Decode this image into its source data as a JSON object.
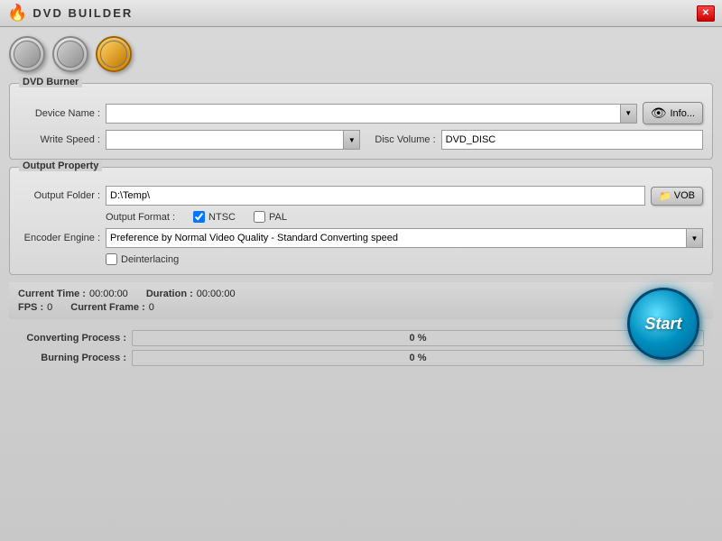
{
  "window": {
    "title": "DVD BUILDER",
    "close_label": "✕"
  },
  "toolbar": {
    "btn1_label": "",
    "btn2_label": "",
    "btn3_label": ""
  },
  "dvd_burner": {
    "title": "DVD Burner",
    "device_name_label": "Device Name :",
    "device_name_value": "",
    "write_speed_label": "Write Speed :",
    "write_speed_value": "",
    "disc_volume_label": "Disc Volume :",
    "disc_volume_value": "DVD_DISC",
    "info_btn_label": "Info..."
  },
  "output_property": {
    "title": "Output Property",
    "output_folder_label": "Output Folder :",
    "output_folder_value": "D:\\Temp\\",
    "vob_btn_label": "VOB",
    "output_format_label": "Output Format :",
    "ntsc_label": "NTSC",
    "ntsc_checked": true,
    "pal_label": "PAL",
    "pal_checked": false,
    "encoder_engine_label": "Encoder Engine :",
    "encoder_engine_value": "Preference by Normal Video Quality - Standard Converting speed",
    "deinterlacing_label": "Deinterlacing",
    "deinterlacing_checked": false
  },
  "status": {
    "current_time_label": "Current Time :",
    "current_time_value": "00:00:00",
    "duration_label": "Duration :",
    "duration_value": "00:00:00",
    "fps_label": "FPS :",
    "fps_value": "0",
    "current_frame_label": "Current Frame :",
    "current_frame_value": "0"
  },
  "progress": {
    "converting_label": "Converting Process :",
    "converting_value": "0 %",
    "converting_percent": 0,
    "burning_label": "Burning Process :",
    "burning_value": "0 %",
    "burning_percent": 0
  },
  "start_button": {
    "label": "Start"
  }
}
